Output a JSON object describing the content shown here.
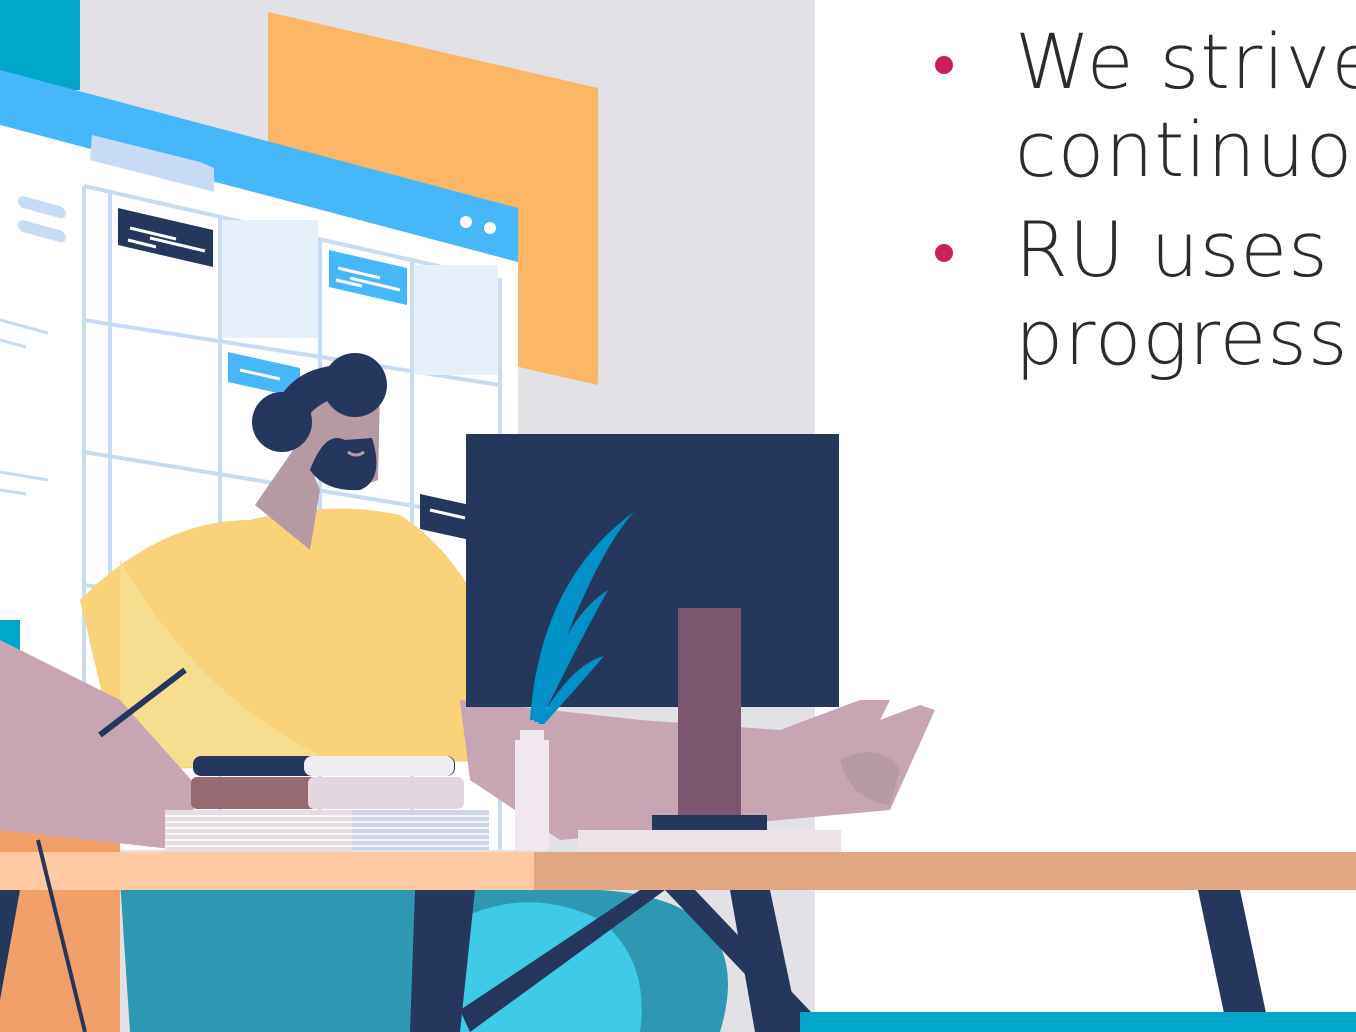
{
  "bullets": [
    {
      "text": "We strive\ncontinuou"
    },
    {
      "text": "RU uses i\nprogressi"
    }
  ],
  "colors": {
    "bullet": "#cc2158",
    "text": "#2c2c2c",
    "background_panel": "#e2e1e5",
    "accent_teal": "#00a7c9",
    "orange_panel": "#fbb766",
    "browser_blue": "#47b7fc",
    "monitor_navy": "#25375d",
    "desk": "#e1a783",
    "shirt": "#f9d27a",
    "skin": "#b69aa3"
  },
  "illustration": {
    "alt": "person-working-at-computer"
  }
}
